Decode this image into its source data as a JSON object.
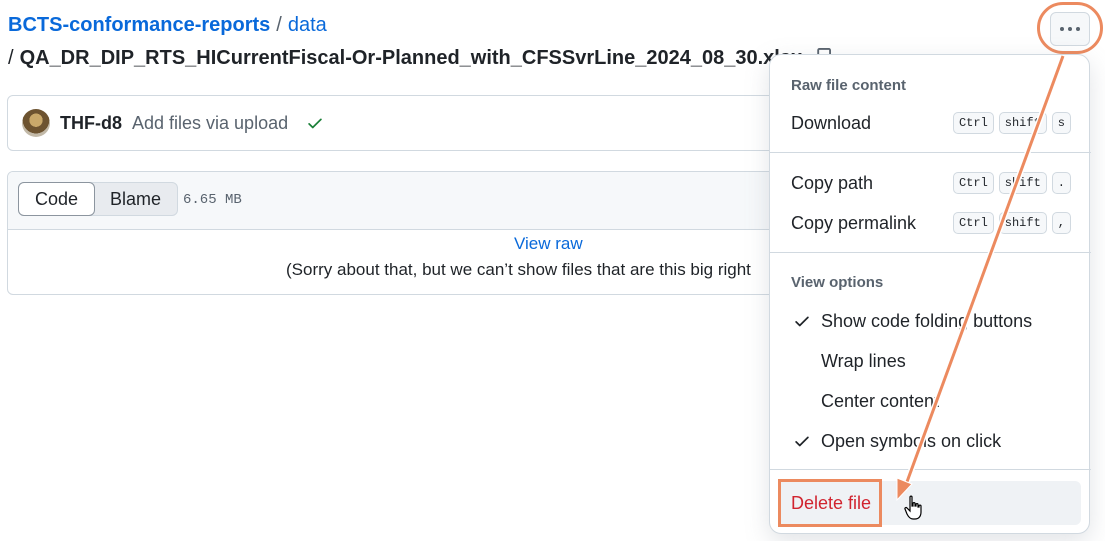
{
  "breadcrumb": {
    "repo": "BCTS-conformance-reports",
    "separator": "/",
    "directory": "data",
    "file_prefix": "/",
    "file": "QA_DR_DIP_RTS_HICurrentFiscal-Or-Planned_with_CFSSvrLine_2024_08_30.xlsx"
  },
  "commit": {
    "user": "THF-d8",
    "message": "Add files via upload"
  },
  "file_view": {
    "tabs": [
      "Code",
      "Blame"
    ],
    "size": "6.65 MB",
    "view_raw": "View raw",
    "notice": "(Sorry about that, but we can’t show files that are this big right"
  },
  "menu": {
    "raw_title": "Raw file content",
    "download": {
      "label": "Download",
      "keys": [
        "Ctrl",
        "shift",
        "s"
      ]
    },
    "copy_path": {
      "label": "Copy path",
      "keys": [
        "Ctrl",
        "shift",
        "."
      ]
    },
    "copy_permalink": {
      "label": "Copy permalink",
      "keys": [
        "Ctrl",
        "shift",
        ","
      ]
    },
    "view_title": "View options",
    "options": [
      {
        "label": "Show code folding buttons",
        "checked": true
      },
      {
        "label": "Wrap lines",
        "checked": false
      },
      {
        "label": "Center content",
        "checked": false
      },
      {
        "label": "Open symbols on click",
        "checked": true
      }
    ],
    "delete": "Delete file"
  },
  "colors": {
    "link": "#0969da",
    "danger": "#d1242f",
    "highlight": "#ec8a5f",
    "success": "#1a7f37"
  }
}
